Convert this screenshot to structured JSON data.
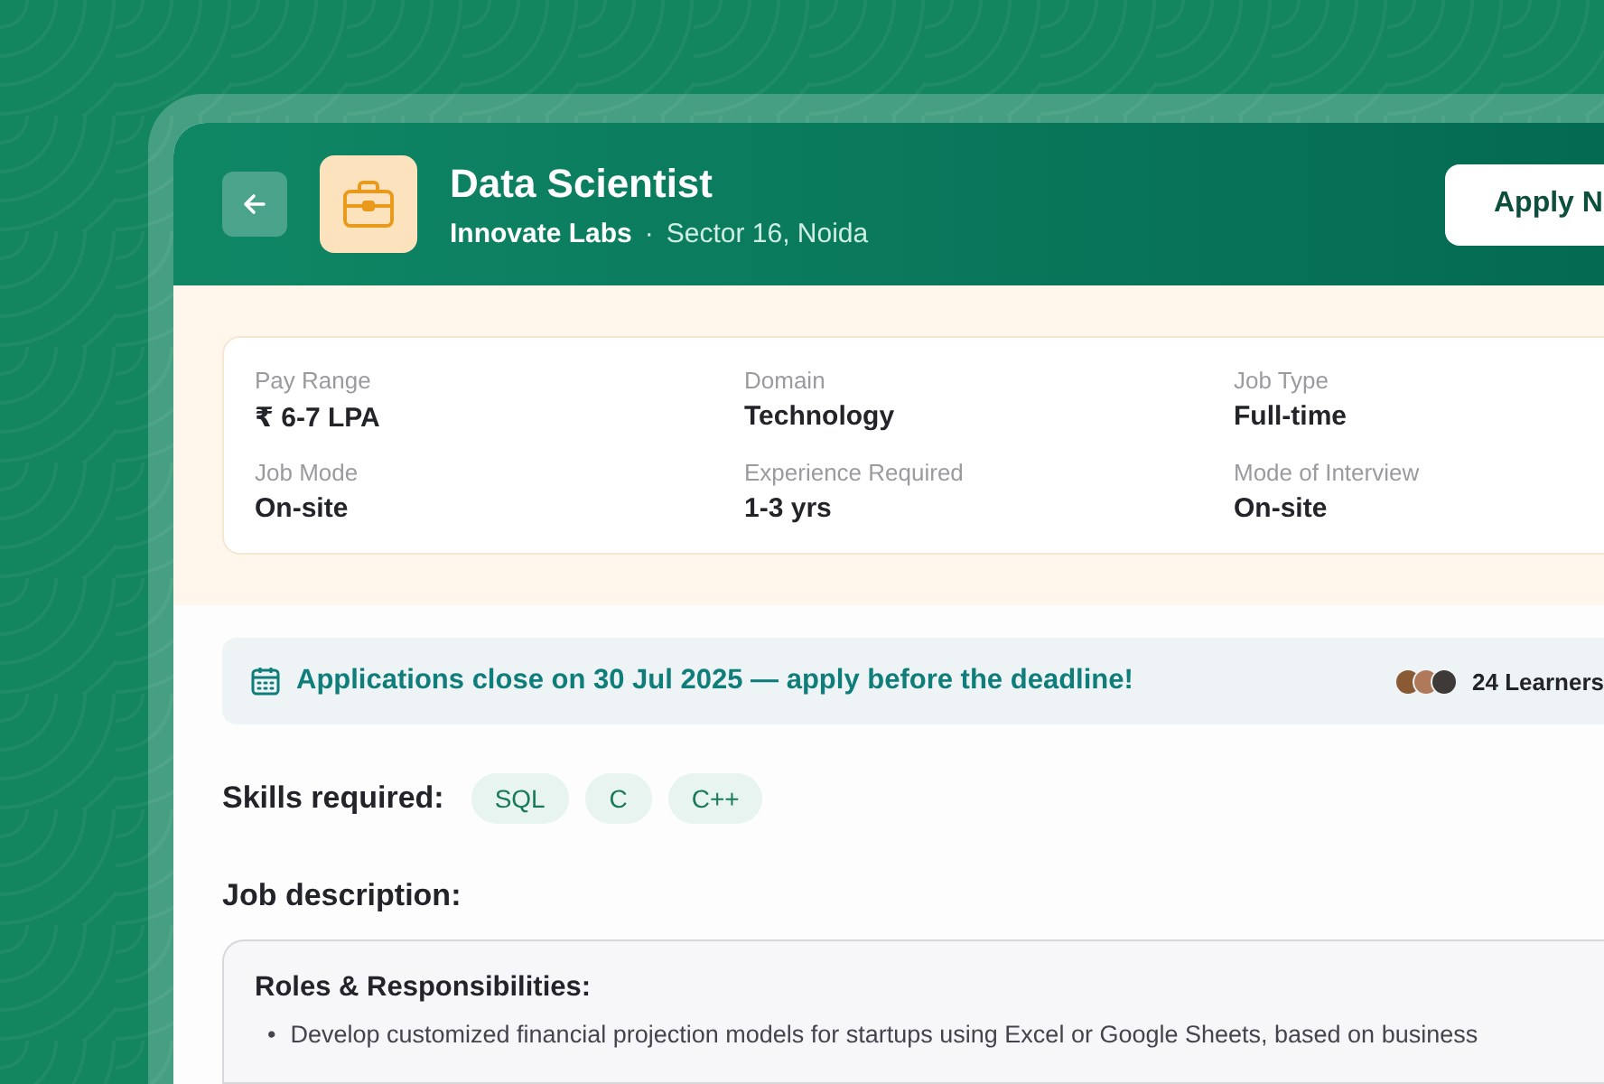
{
  "header": {
    "title": "Data Scientist",
    "company": "Innovate Labs",
    "separator": "·",
    "location": "Sector 16, Noida",
    "apply_button": "Apply N"
  },
  "details": [
    {
      "label": "Pay Range",
      "value": "₹ 6-7 LPA"
    },
    {
      "label": "Domain",
      "value": "Technology"
    },
    {
      "label": "Job Type",
      "value": "Full-time"
    },
    {
      "label": "Job Mode",
      "value": "On-site"
    },
    {
      "label": "Experience Required",
      "value": "1-3 yrs"
    },
    {
      "label": "Mode of Interview",
      "value": "On-site"
    }
  ],
  "deadline": {
    "text": "Applications close on 30 Jul 2025 — apply before the deadline!",
    "learners": "24 Learners"
  },
  "skills": {
    "label": "Skills required:",
    "items": [
      "SQL",
      "C",
      "C++"
    ]
  },
  "description": {
    "heading": "Job description:",
    "section_title": "Roles & Responsibilities:",
    "bullets": [
      {
        "marker": "•",
        "text": "Develop customized financial projection models for startups using Excel or Google Sheets, based on business"
      }
    ]
  }
}
